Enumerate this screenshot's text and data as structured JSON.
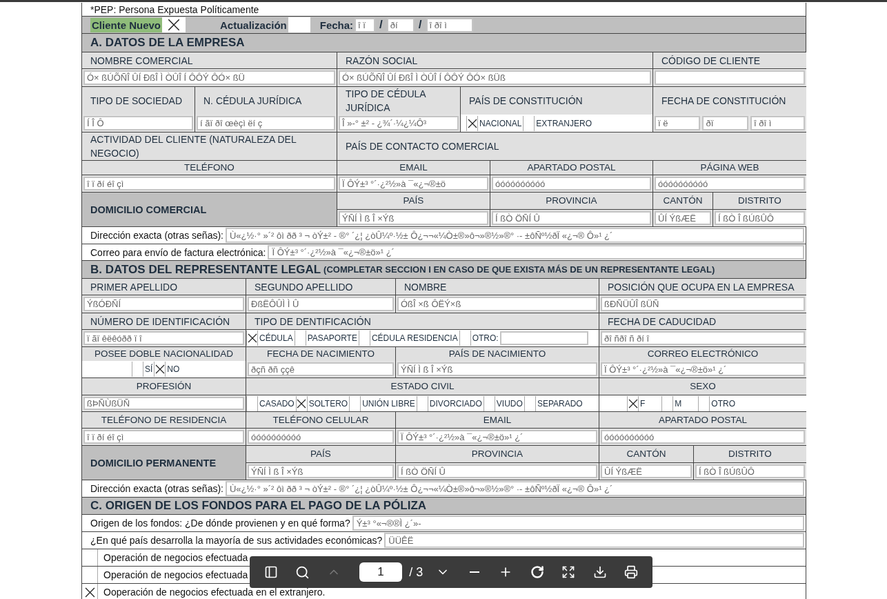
{
  "rows": [
    {
      "kind": "note",
      "text": "*PEP: Persona Expuesta Políticamente"
    },
    {
      "kind": "status",
      "options": [
        {
          "label": "Cliente Nuevo",
          "highlighted": true,
          "checked": true
        },
        {
          "label": "Actualización",
          "highlighted": false,
          "checked": false
        }
      ],
      "date_label": "Fecha:",
      "date": [
        {
          "kind": "field",
          "value": "î ï"
        },
        {
          "kind": "sep",
          "text": "/"
        },
        {
          "kind": "field",
          "value": "ðí"
        },
        {
          "kind": "sep",
          "text": "/"
        },
        {
          "kind": "field",
          "value": "î ðî ì"
        }
      ]
    },
    {
      "kind": "section",
      "title": "A. DATOS DE LA EMPRESA"
    },
    {
      "kind": "labels",
      "cells": [
        "NOMBRE COMERCIAL",
        "RAZÓN SOCIAL",
        "CÓDIGO DE CLIENTE"
      ]
    },
    {
      "kind": "values",
      "cells": [
        {
          "kind": "field",
          "value": "Ó× ßÚÕÑÎ ÛÍ ÐßÎ Ì ÒÛÎ Í ÔÔÝ ÔÓ× ßÜ"
        },
        {
          "kind": "field",
          "value": "Ó× ßÚÕÑÎ ÛÍ ÐßÎ Ì ÒÛÎ Í ÔÔÝ ÔÓ× ßÜß"
        },
        {
          "kind": "field"
        }
      ]
    },
    {
      "kind": "labels",
      "cells": [
        "TIPO DE SOCIEDAD",
        "N. CÉDULA JURÍDICA",
        "TIPO DE CÉDULA JURÍDICA",
        "PAÍS DE CONSTITUCIÓN",
        "FECHA DE CONSTITUCIÓN"
      ]
    },
    {
      "kind": "values",
      "cells": [
        {
          "kind": "field",
          "value": "Í Î Ô"
        },
        {
          "kind": "field",
          "value": "í ãï ðî œèçì ëí ç"
        },
        {
          "kind": "field",
          "value": "Î »-° ±² - ¿¾´·¼¿¼Ô³"
        },
        {
          "kind": "choices",
          "options": [
            {
              "kind": "plain",
              "label": "NACIONAL",
              "checked": true
            },
            {
              "kind": "plain",
              "label": "EXTRANJERO",
              "checked": false
            }
          ]
        },
        {
          "kind": "dates",
          "parts": [
            "ï ë",
            "ðï",
            "î ðî ì"
          ]
        }
      ]
    },
    {
      "kind": "labels",
      "cells": [
        "ACTIVIDAD DEL CLIENTE (NATURALEZA DEL NEGOCIO)",
        "PAÍS DE CONTACTO COMERCIAL"
      ]
    },
    {
      "kind": "headers",
      "cells": [
        "TELÉFONO",
        "EMAIL",
        "APARTADO POSTAL",
        "PÁGINA WEB"
      ]
    },
    {
      "kind": "values",
      "cells": [
        {
          "kind": "field",
          "value": "î ï ðí éî çì"
        },
        {
          "kind": "field",
          "value": "Ï ÔÝ±³ °´·¿²½»à ¯«¿¬®±ö"
        },
        {
          "kind": "field",
          "value": "óóóóóóóóóó"
        },
        {
          "kind": "field",
          "value": "óóóóóóóóóó"
        }
      ]
    },
    {
      "kind": "group",
      "title": "DOMICILIO COMERCIAL",
      "headers": [
        "PAÍS",
        "PROVINCIA",
        "CANTÓN",
        "DISTRITO"
      ],
      "values": [
        "ÝÑÍ Ì ß Î ×Ýß",
        "Í ßÒ ÖÑÍ Û",
        "ÛÍ ÝßÆË",
        "Í ßÒ Î ßÚßÛÔ"
      ]
    },
    {
      "kind": "line",
      "label": "Dirección exacta (otras señas):",
      "value": "Ù«¿½·° »´² ôì ðð ³ ¬ òÝ±² - ®° ´¿¦ ¿òÛ¼º·½± Ô¿¬¬«¼Ò±®»ô¬»®½»®° ·- ±ôÑº½ðÏ «¿¬® Ô»¹ ¿´"
    },
    {
      "kind": "line",
      "label": "Correo para envío de factura electrónica:",
      "value": "Ï ÔÝ±³ °´·¿²½»à ¯«¿¬®±ö»¹ ¿´"
    },
    {
      "kind": "section",
      "title": "B. DATOS DEL REPRESENTANTE LEGAL",
      "subtitle": "(COMPLETAR SECCION I EN CASO DE QUE EXISTA MÁS DE UN REPRESENTANTE LEGAL)"
    },
    {
      "kind": "labels",
      "cells": [
        "PRIMER APELLIDO",
        "SEGUNDO APELLIDO",
        "NOMBRE",
        "POSICIÓN QUE OCUPA EN LA EMPRESA"
      ]
    },
    {
      "kind": "values",
      "cells": [
        {
          "kind": "field",
          "value": "ÝßÓÐÑÍ"
        },
        {
          "kind": "field",
          "value": "ÐßËÔÛÌ Ì Û"
        },
        {
          "kind": "field",
          "value": "ÓßÎ ×ß ÔËÝ×ß"
        },
        {
          "kind": "field",
          "value": "ßÐÑÜÛÎ ßÜÑ"
        }
      ]
    },
    {
      "kind": "labels",
      "cells": [
        "NÚMERO DE IDENTIFICACIÓN",
        "TIPO DE DENTIFICACIÓN",
        "FECHA DE CADUCIDAD"
      ]
    },
    {
      "kind": "values",
      "cells": [
        {
          "kind": "field",
          "value": "ï ãï êëêóðð ï î"
        },
        {
          "kind": "choices",
          "options": [
            {
              "kind": "plain",
              "label": "CÉDULA",
              "checked": true
            },
            {
              "kind": "plain",
              "label": "PASAPORTE",
              "checked": false
            },
            {
              "kind": "plain",
              "label": "CÉDULA RESIDENCIA",
              "checked": false
            },
            {
              "kind": "with_field",
              "label": "OTRO:",
              "checked": false
            }
          ]
        },
        {
          "kind": "field",
          "value": "ðî ñðî ñ ðí î"
        }
      ]
    },
    {
      "kind": "headers",
      "cells": [
        "POSEE DOBLE NACIONALIDAD",
        "FECHA DE NACIMIENTO",
        "PAÍS DE NACIMIENTO",
        "CORREO ELECTRÓNICO"
      ]
    },
    {
      "kind": "values",
      "cells": [
        {
          "kind": "choices",
          "options": [
            {
              "kind": "plain",
              "label": "SÍ",
              "checked": false
            },
            {
              "kind": "plain",
              "label": "NO",
              "checked": true
            }
          ]
        },
        {
          "kind": "field",
          "value": "ðçñ ðñ ççê"
        },
        {
          "kind": "field",
          "value": "ÝÑÍ Ì ß Î ×Ýß"
        },
        {
          "kind": "field",
          "value": "Ï ÔÝ±³ °´·¿²½»à ¯«¿¬®±ö»¹ ¿´"
        }
      ]
    },
    {
      "kind": "headers",
      "cells": [
        "PROFESIÓN",
        "ESTADO CIVIL",
        "SEXO"
      ]
    },
    {
      "kind": "values",
      "cells": [
        {
          "kind": "field",
          "value": "ßÞÑÙßÜÑ"
        },
        {
          "kind": "choices",
          "options": [
            {
              "kind": "plain",
              "label": "CASADO",
              "checked": false
            },
            {
              "kind": "plain",
              "label": "SOLTERO",
              "checked": true
            },
            {
              "kind": "plain",
              "label": "UNIÓN LIBRE",
              "checked": false
            },
            {
              "kind": "plain",
              "label": "DIVORCIADO",
              "checked": false
            },
            {
              "kind": "plain",
              "label": "VIUDO",
              "checked": false
            },
            {
              "kind": "plain",
              "label": "SEPARADO",
              "checked": false
            }
          ]
        },
        {
          "kind": "choices",
          "options": [
            {
              "kind": "plain",
              "label": "F",
              "checked": true
            },
            {
              "kind": "plain",
              "label": "M",
              "checked": false
            },
            {
              "kind": "plain",
              "label": "OTRO",
              "checked": false
            }
          ]
        }
      ]
    },
    {
      "kind": "headers",
      "cells": [
        "TELÉFONO DE RESIDENCIA",
        "TELÉFONO CELULAR",
        "EMAIL",
        "APARTADO POSTAL"
      ]
    },
    {
      "kind": "values",
      "cells": [
        {
          "kind": "field",
          "value": "î ï ðí éî çì"
        },
        {
          "kind": "field",
          "value": "óóóóóóóóóó"
        },
        {
          "kind": "field",
          "value": "Ï ÔÝ±³ °´·¿²½»à ¯«¿¬®±ö»¹ ¿´"
        },
        {
          "kind": "field",
          "value": "óóóóóóóóóó"
        }
      ]
    },
    {
      "kind": "group",
      "title": "DOMICILIO PERMANENTE",
      "headers": [
        "PAÍS",
        "PROVINCIA",
        "CANTÓN",
        "DISTRITO"
      ],
      "values": [
        "ÝÑÍ Ì ß Î ×Ýß",
        "Í ßÒ ÖÑÍ Û",
        "ÛÍ ÝßÆË",
        "Í ßÒ Î ßÚßÛÔ"
      ]
    },
    {
      "kind": "line",
      "label": "Dirección exacta (otras señas):",
      "value": "Ù«¿½·° »´² ôì ðð ³ ¬ òÝ±² - ®° ´¿¦ ¿òÛ¼º·½± Ô¿¬¬«¼Ò±®»ô¬»®½»®° ·- ±ôÑº½ðÏ «¿¬® Ô»¹ ¿´"
    },
    {
      "kind": "section",
      "title": "C. ORIGEN DE LOS FONDOS PARA EL PAGO DE LA PÓLIZA"
    },
    {
      "kind": "line",
      "label": "Origen de los fondos: ¿De dónde provienen y en qué forma?",
      "value": "Ý±³ °«¬®®Ì ¿´»-"
    },
    {
      "kind": "line",
      "label": "¿En qué país desarrolla la mayoría de sus actividades económicas?",
      "value": "ÜÜÊË"
    },
    {
      "kind": "option",
      "label": "Operación de negocios efectuada",
      "checked": false
    },
    {
      "kind": "option",
      "label": "Operación de negocios efectuada",
      "checked": false
    },
    {
      "kind": "option",
      "label": "Ooperación de negocios efectuada en el extranjero.",
      "checked": true
    }
  ],
  "toolbar": {
    "page": "1",
    "total": "/ 3",
    "prev_disabled": true
  }
}
